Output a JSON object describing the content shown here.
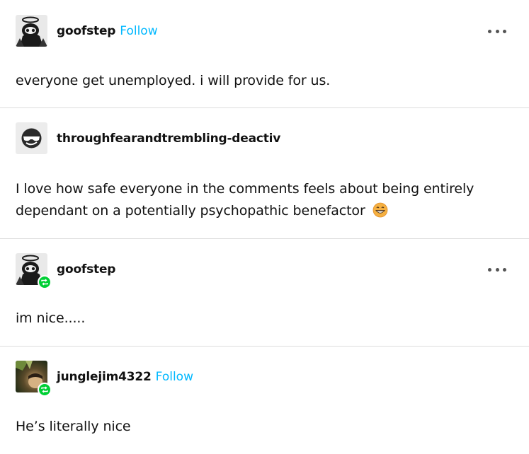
{
  "posts": [
    {
      "username": "goofstep",
      "follow_label": "Follow",
      "has_follow": true,
      "has_more": true,
      "reblogged": false,
      "avatar_icon": "haloed-skull-avatar-icon",
      "body": "everyone get unemployed. i will provide for us."
    },
    {
      "username": "throughfearandtrembling-deactiv",
      "has_follow": false,
      "has_more": false,
      "reblogged": false,
      "avatar_icon": "sunglasses-face-avatar-icon",
      "body": "I love how safe everyone in the comments feels about being entirely dependant on a potentially psychopathic benefactor",
      "emoji": "grinning-face-emoji"
    },
    {
      "username": "goofstep",
      "has_follow": false,
      "has_more": true,
      "reblogged": true,
      "avatar_icon": "haloed-skull-avatar-icon",
      "body": "im nice....."
    },
    {
      "username": "junglejim4322",
      "follow_label": "Follow",
      "has_follow": true,
      "has_more": false,
      "reblogged": true,
      "avatar_icon": "photo-portrait-avatar-icon",
      "body": "He’s literally nice"
    }
  ],
  "colors": {
    "follow": "#00b8ff",
    "reblog_badge": "#00cf35",
    "divider": "#dcdcdc",
    "text": "#111111"
  }
}
